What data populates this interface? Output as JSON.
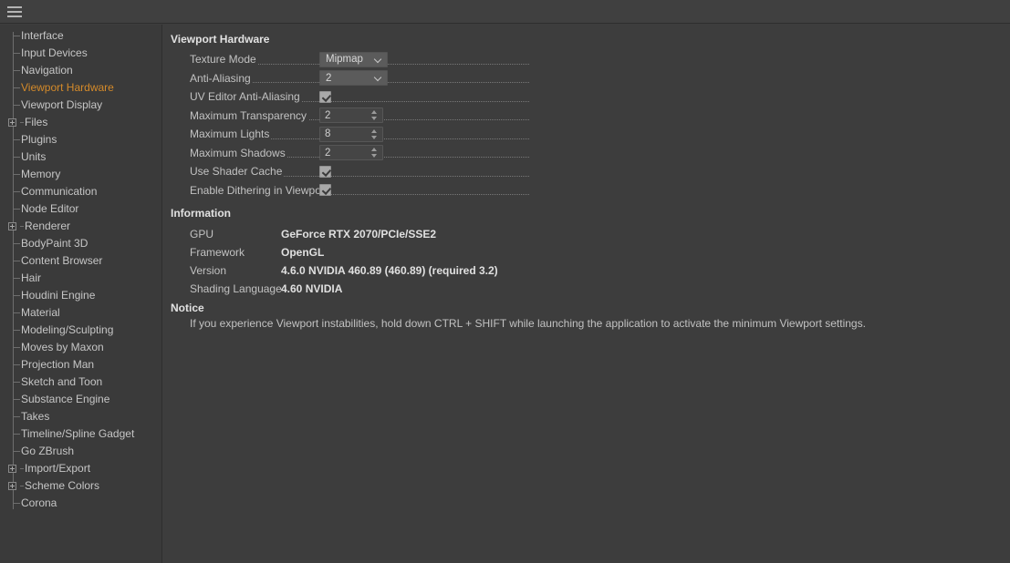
{
  "toolbar": {
    "menu_icon": "hamburger-icon"
  },
  "sidebar": {
    "items": [
      {
        "label": "Interface",
        "expandable": false,
        "selected": false
      },
      {
        "label": "Input Devices",
        "expandable": false,
        "selected": false
      },
      {
        "label": "Navigation",
        "expandable": false,
        "selected": false
      },
      {
        "label": "Viewport Hardware",
        "expandable": false,
        "selected": true
      },
      {
        "label": "Viewport Display",
        "expandable": false,
        "selected": false
      },
      {
        "label": "Files",
        "expandable": true,
        "selected": false
      },
      {
        "label": "Plugins",
        "expandable": false,
        "selected": false
      },
      {
        "label": "Units",
        "expandable": false,
        "selected": false
      },
      {
        "label": "Memory",
        "expandable": false,
        "selected": false
      },
      {
        "label": "Communication",
        "expandable": false,
        "selected": false
      },
      {
        "label": "Node Editor",
        "expandable": false,
        "selected": false
      },
      {
        "label": "Renderer",
        "expandable": true,
        "selected": false
      },
      {
        "label": "BodyPaint 3D",
        "expandable": false,
        "selected": false
      },
      {
        "label": "Content Browser",
        "expandable": false,
        "selected": false
      },
      {
        "label": "Hair",
        "expandable": false,
        "selected": false
      },
      {
        "label": "Houdini Engine",
        "expandable": false,
        "selected": false
      },
      {
        "label": "Material",
        "expandable": false,
        "selected": false
      },
      {
        "label": "Modeling/Sculpting",
        "expandable": false,
        "selected": false
      },
      {
        "label": "Moves by Maxon",
        "expandable": false,
        "selected": false
      },
      {
        "label": "Projection Man",
        "expandable": false,
        "selected": false
      },
      {
        "label": "Sketch and Toon",
        "expandable": false,
        "selected": false
      },
      {
        "label": "Substance Engine",
        "expandable": false,
        "selected": false
      },
      {
        "label": "Takes",
        "expandable": false,
        "selected": false
      },
      {
        "label": "Timeline/Spline Gadget",
        "expandable": false,
        "selected": false
      },
      {
        "label": "Go ZBrush",
        "expandable": false,
        "selected": false
      },
      {
        "label": "Import/Export",
        "expandable": true,
        "selected": false
      },
      {
        "label": "Scheme Colors",
        "expandable": true,
        "selected": false
      },
      {
        "label": "Corona",
        "expandable": false,
        "selected": false
      }
    ],
    "selected_color": "#d48a2a"
  },
  "main": {
    "viewport_hardware": {
      "title": "Viewport Hardware",
      "rows": [
        {
          "label": "Texture Mode",
          "type": "dropdown",
          "value": "Mipmap"
        },
        {
          "label": "Anti-Aliasing",
          "type": "dropdown",
          "value": "2"
        },
        {
          "label": "UV Editor Anti-Aliasing",
          "type": "checkbox",
          "value": true
        },
        {
          "label": "Maximum Transparency",
          "type": "number",
          "value": "2"
        },
        {
          "label": "Maximum Lights",
          "type": "number",
          "value": "8"
        },
        {
          "label": "Maximum Shadows",
          "type": "number",
          "value": "2"
        },
        {
          "label": "Use Shader Cache",
          "type": "checkbox",
          "value": true
        },
        {
          "label": "Enable Dithering in Viewport",
          "type": "checkbox",
          "value": true
        }
      ]
    },
    "information": {
      "title": "Information",
      "rows": [
        {
          "key": "GPU",
          "value": "GeForce RTX 2070/PCIe/SSE2"
        },
        {
          "key": "Framework",
          "value": "OpenGL"
        },
        {
          "key": "Version",
          "value": "4.6.0 NVIDIA 460.89 (460.89) (required 3.2)"
        },
        {
          "key": "Shading Language",
          "value": "4.60 NVIDIA"
        }
      ]
    },
    "notice": {
      "title": "Notice",
      "text": "If you experience Viewport instabilities, hold down CTRL + SHIFT while launching the application to activate the minimum Viewport settings."
    }
  }
}
